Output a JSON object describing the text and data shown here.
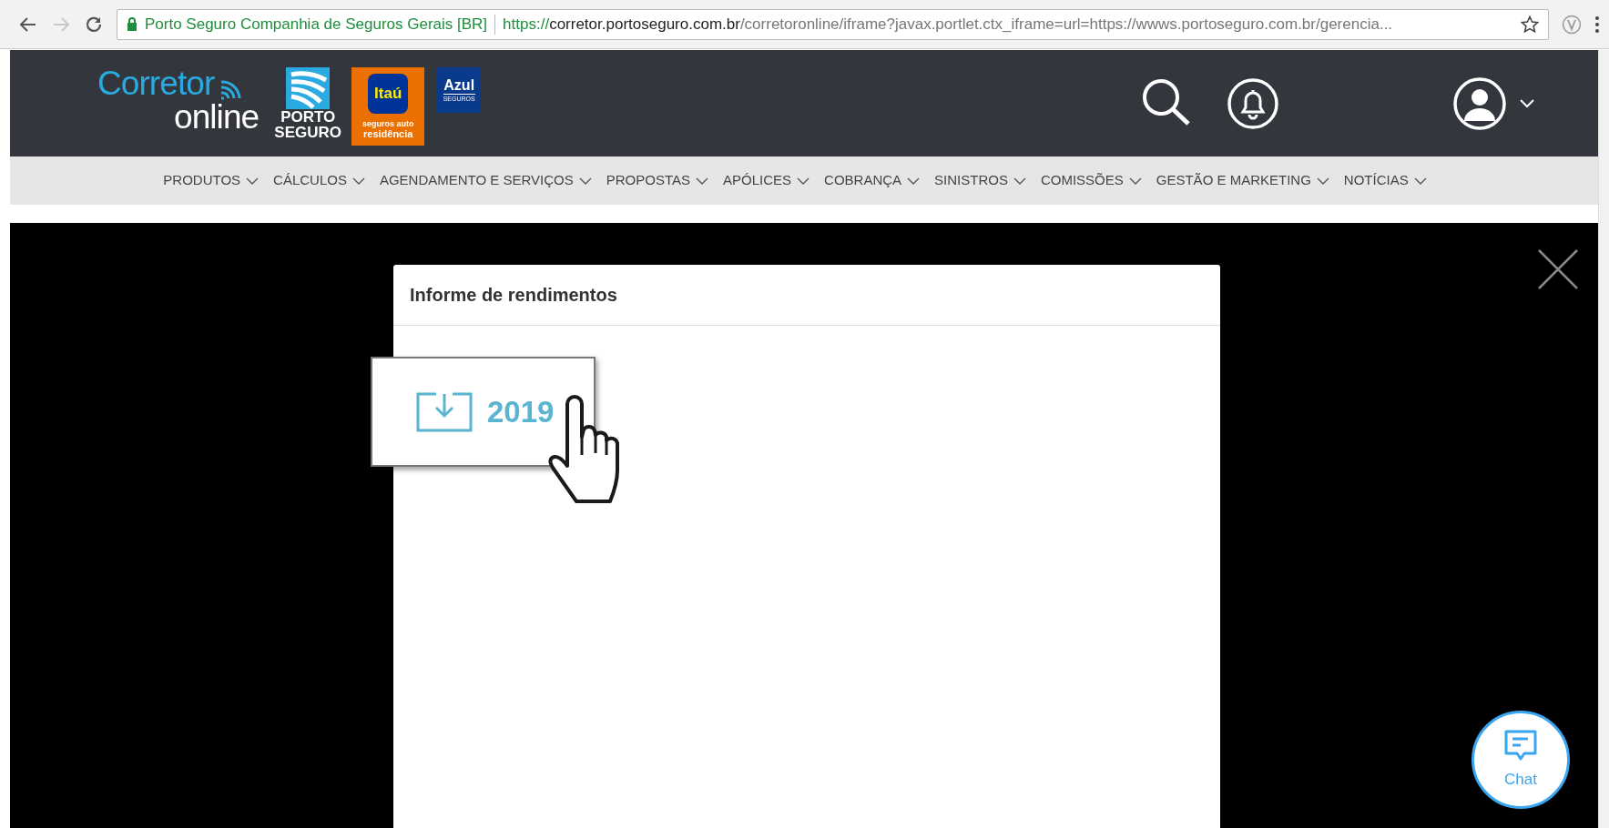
{
  "browser": {
    "site_identity": "Porto Seguro Companhia de Seguros Gerais [BR]",
    "url": {
      "scheme": "https://",
      "host": "corretor.portoseguro.com.br",
      "path": "/corretoronline/iframe?javax.portlet.ctx_iframe=url=https://wwws.portoseguro.com.br/gerencia..."
    },
    "forward_disabled": true
  },
  "header": {
    "logo": {
      "line_1": "Corretor",
      "line_2": "online"
    },
    "partners": [
      {
        "kind": "porto",
        "lines": [
          "PORTO",
          "SEGURO"
        ]
      },
      {
        "kind": "itau",
        "lines": [
          "Itaú",
          "seguros auto",
          "residência"
        ]
      },
      {
        "kind": "azul",
        "lines": [
          "Azul",
          "SEGUROS"
        ]
      }
    ]
  },
  "nav": [
    "PRODUTOS",
    "CÁLCULOS",
    "AGENDAMENTO E SERVIÇOS",
    "PROPOSTAS",
    "APÓLICES",
    "COBRANÇA",
    "SINISTROS",
    "COMISSÕES",
    "GESTÃO E MARKETING",
    "NOTÍCIAS"
  ],
  "modal": {
    "title": "Informe de rendimentos",
    "download": {
      "label": "2019"
    }
  },
  "chat": {
    "label": "Chat"
  }
}
